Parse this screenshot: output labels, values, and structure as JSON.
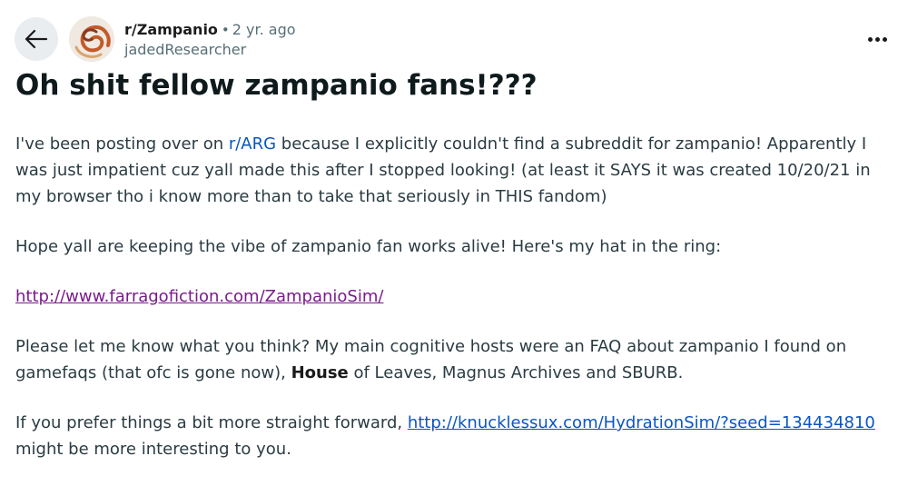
{
  "post": {
    "subreddit": "r/Zampanio",
    "separator": "•",
    "age": "2 yr. ago",
    "author": "jadedResearcher",
    "title": "Oh shit fellow zampanio fans!???",
    "p1_before": "I've been posting over on ",
    "p1_link": "r/ARG",
    "p1_after": " because I explicitly couldn't find a subreddit for zampanio! Apparently I was just impatient cuz yall made this after I stopped looking! (at least it SAYS it was created 10/20/21 in my browser tho i know more than to take that seriously in THIS fandom)",
    "p2": "Hope yall are keeping the vibe of zampanio fan works alive! Here's my hat in the ring:",
    "p3_link": "http://www.farragofiction.com/ZampanioSim/",
    "p4_before": "Please let me know what you think? My main cognitive hosts were an FAQ about zampanio I found on gamefaqs (that ofc is gone now), ",
    "p4_bold": "House",
    "p4_after": " of Leaves, Magnus Archives and SBURB.",
    "p5_before": "If you prefer things a bit more straight forward, ",
    "p5_link": "http://knucklessux.com/HydrationSim/?seed=134434810",
    "p5_after": " might be more interesting to you."
  },
  "icons": {
    "back": "arrow-left-icon",
    "avatar": "spiral-avatar",
    "more": "more-horizontal-icon"
  },
  "colors": {
    "link": "#0a55c2",
    "visited_link": "#7a1a8b",
    "muted": "#576f76",
    "back_bg": "#eaedef"
  }
}
